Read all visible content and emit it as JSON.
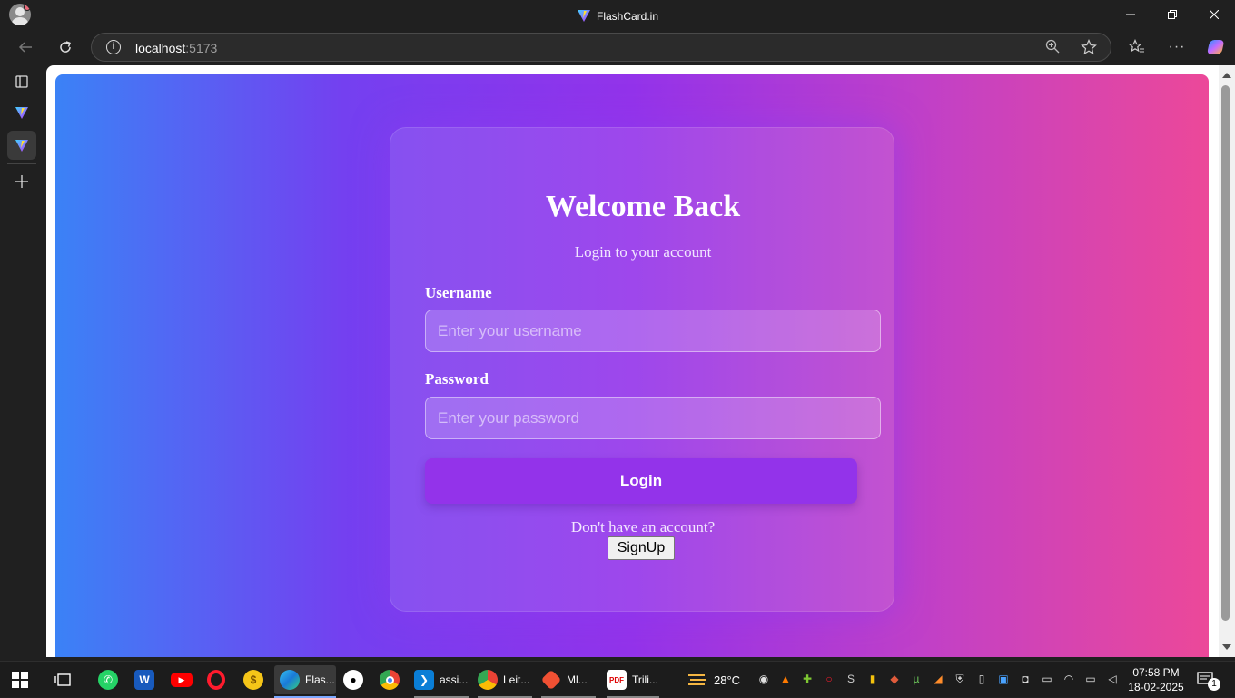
{
  "window": {
    "title": "FlashCard.in",
    "controls": {
      "minimize": "—",
      "restore": "❐",
      "close": "✕"
    }
  },
  "addressbar": {
    "host": "localhost",
    "port": ":5173"
  },
  "page": {
    "heading": "Welcome Back",
    "subheading": "Login to your account",
    "username_label": "Username",
    "username_placeholder": "Enter your username",
    "password_label": "Password",
    "password_placeholder": "Enter your password",
    "login_button": "Login",
    "no_account_text": "Don't have an account?",
    "signup_button": "SignUp"
  },
  "taskbar": {
    "apps": [
      {
        "name": "start",
        "icon": "windows-icon"
      },
      {
        "name": "task-view",
        "icon": "task-view-icon"
      },
      {
        "name": "whatsapp",
        "icon": "whatsapp-icon"
      },
      {
        "name": "word",
        "icon": "word-icon"
      },
      {
        "name": "youtube",
        "icon": "youtube-icon"
      },
      {
        "name": "opera",
        "icon": "opera-icon"
      },
      {
        "name": "coins",
        "icon": "coins-icon"
      },
      {
        "name": "edge",
        "icon": "edge-icon",
        "label": "Flas..."
      },
      {
        "name": "github",
        "icon": "github-icon"
      },
      {
        "name": "chrome",
        "icon": "chrome-icon"
      },
      {
        "name": "vscode",
        "icon": "vscode-icon",
        "label": "assi..."
      },
      {
        "name": "chrome-profile",
        "icon": "chrome-profile-icon",
        "label": "Leit..."
      },
      {
        "name": "git",
        "icon": "git-icon",
        "label": "Ml..."
      },
      {
        "name": "pdf",
        "icon": "pdf-icon",
        "label": "Trili..."
      }
    ],
    "weather": "28°C",
    "time": "07:58 PM",
    "date": "18-02-2025",
    "notifications": "1"
  },
  "colors": {
    "gradient_start": "#3b82f6",
    "gradient_mid": "#9333ea",
    "gradient_end": "#ec4899",
    "login_button": "#9333ea"
  }
}
